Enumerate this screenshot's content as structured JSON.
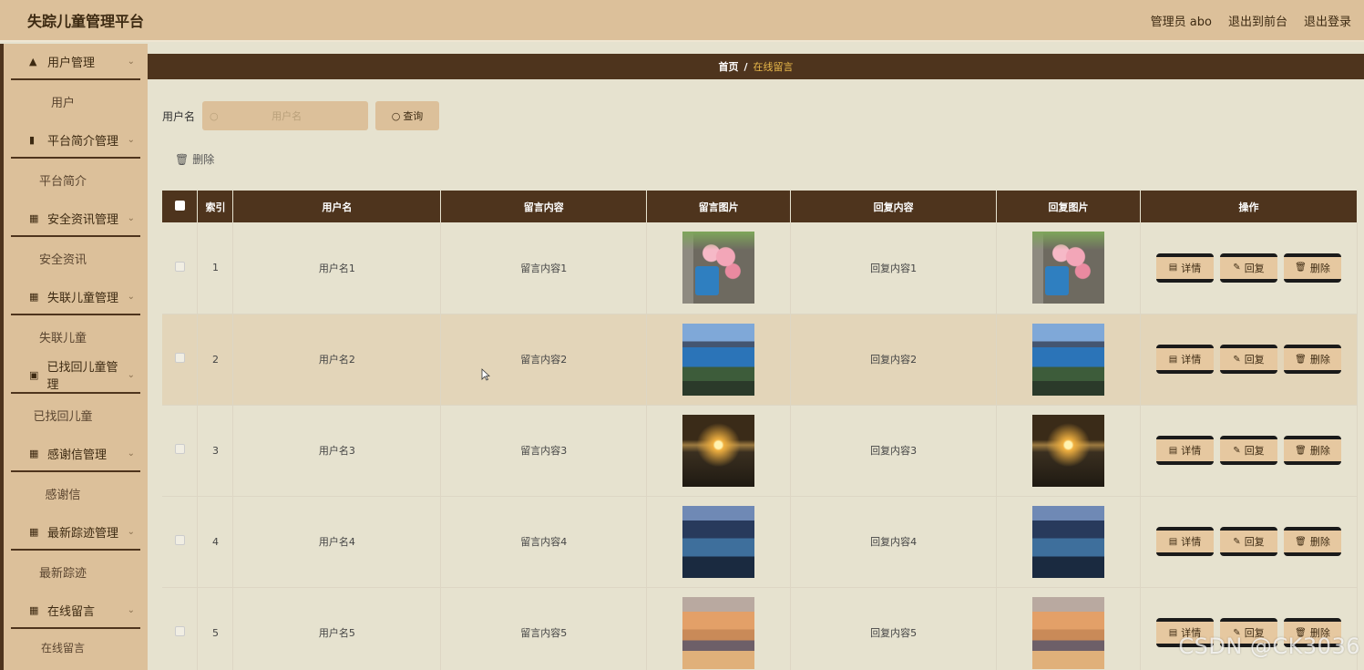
{
  "header": {
    "title": "失踪儿童管理平台",
    "admin": "管理员 abo",
    "back_front": "退出到前台",
    "logout": "退出登录"
  },
  "sidebar": {
    "groups": [
      {
        "label": "用户管理",
        "icon": "lock-icon",
        "item": "用户"
      },
      {
        "label": "平台简介管理",
        "icon": "chart-icon",
        "item": "平台简介"
      },
      {
        "label": "安全资讯管理",
        "icon": "grid-icon",
        "item": "安全资讯"
      },
      {
        "label": "失联儿童管理",
        "icon": "grid-icon",
        "item": "失联儿童"
      },
      {
        "label": "已找回儿童管理",
        "icon": "clipboard-icon",
        "item": "已找回儿童"
      },
      {
        "label": "感谢信管理",
        "icon": "grid-icon",
        "item": "感谢信"
      },
      {
        "label": "最新踪迹管理",
        "icon": "grid-icon",
        "item": "最新踪迹"
      },
      {
        "label": "在线留言",
        "icon": "grid-icon",
        "item": "在线留言"
      }
    ]
  },
  "breadcrumb": {
    "home": "首页",
    "separator": "/",
    "current": "在线留言"
  },
  "search": {
    "label": "用户名",
    "placeholder": "用户名",
    "value": "",
    "button": "查询"
  },
  "toolbar": {
    "delete": "删除"
  },
  "table": {
    "headers": [
      "索引",
      "用户名",
      "留言内容",
      "留言图片",
      "回复内容",
      "回复图片",
      "操作"
    ],
    "rows": [
      {
        "index": "1",
        "username": "用户名1",
        "content": "留言内容1",
        "image": "pink-flowers-photo",
        "reply": "回复内容1",
        "reply_image": "pink-flowers-photo"
      },
      {
        "index": "2",
        "username": "用户名2",
        "content": "留言内容2",
        "image": "lake-photo",
        "reply": "回复内容2",
        "reply_image": "lake-photo"
      },
      {
        "index": "3",
        "username": "用户名3",
        "content": "留言内容3",
        "image": "sunset-photo",
        "reply": "回复内容3",
        "reply_image": "sunset-photo"
      },
      {
        "index": "4",
        "username": "用户名4",
        "content": "留言内容4",
        "image": "river-photo",
        "reply": "回复内容4",
        "reply_image": "river-photo"
      },
      {
        "index": "5",
        "username": "用户名5",
        "content": "留言内容5",
        "image": "clouds-photo",
        "reply": "回复内容5",
        "reply_image": "clouds-photo"
      }
    ],
    "actions": {
      "detail": "详情",
      "reply": "回复",
      "delete": "删除"
    }
  },
  "watermark": "CSDN @CK3036",
  "colors": {
    "header_bg": "#dcc09a",
    "dark_brown": "#4e341d",
    "page_bg": "#e6e2cf",
    "alt_row": "#e3d5b9",
    "accent": "#e8b84a"
  }
}
